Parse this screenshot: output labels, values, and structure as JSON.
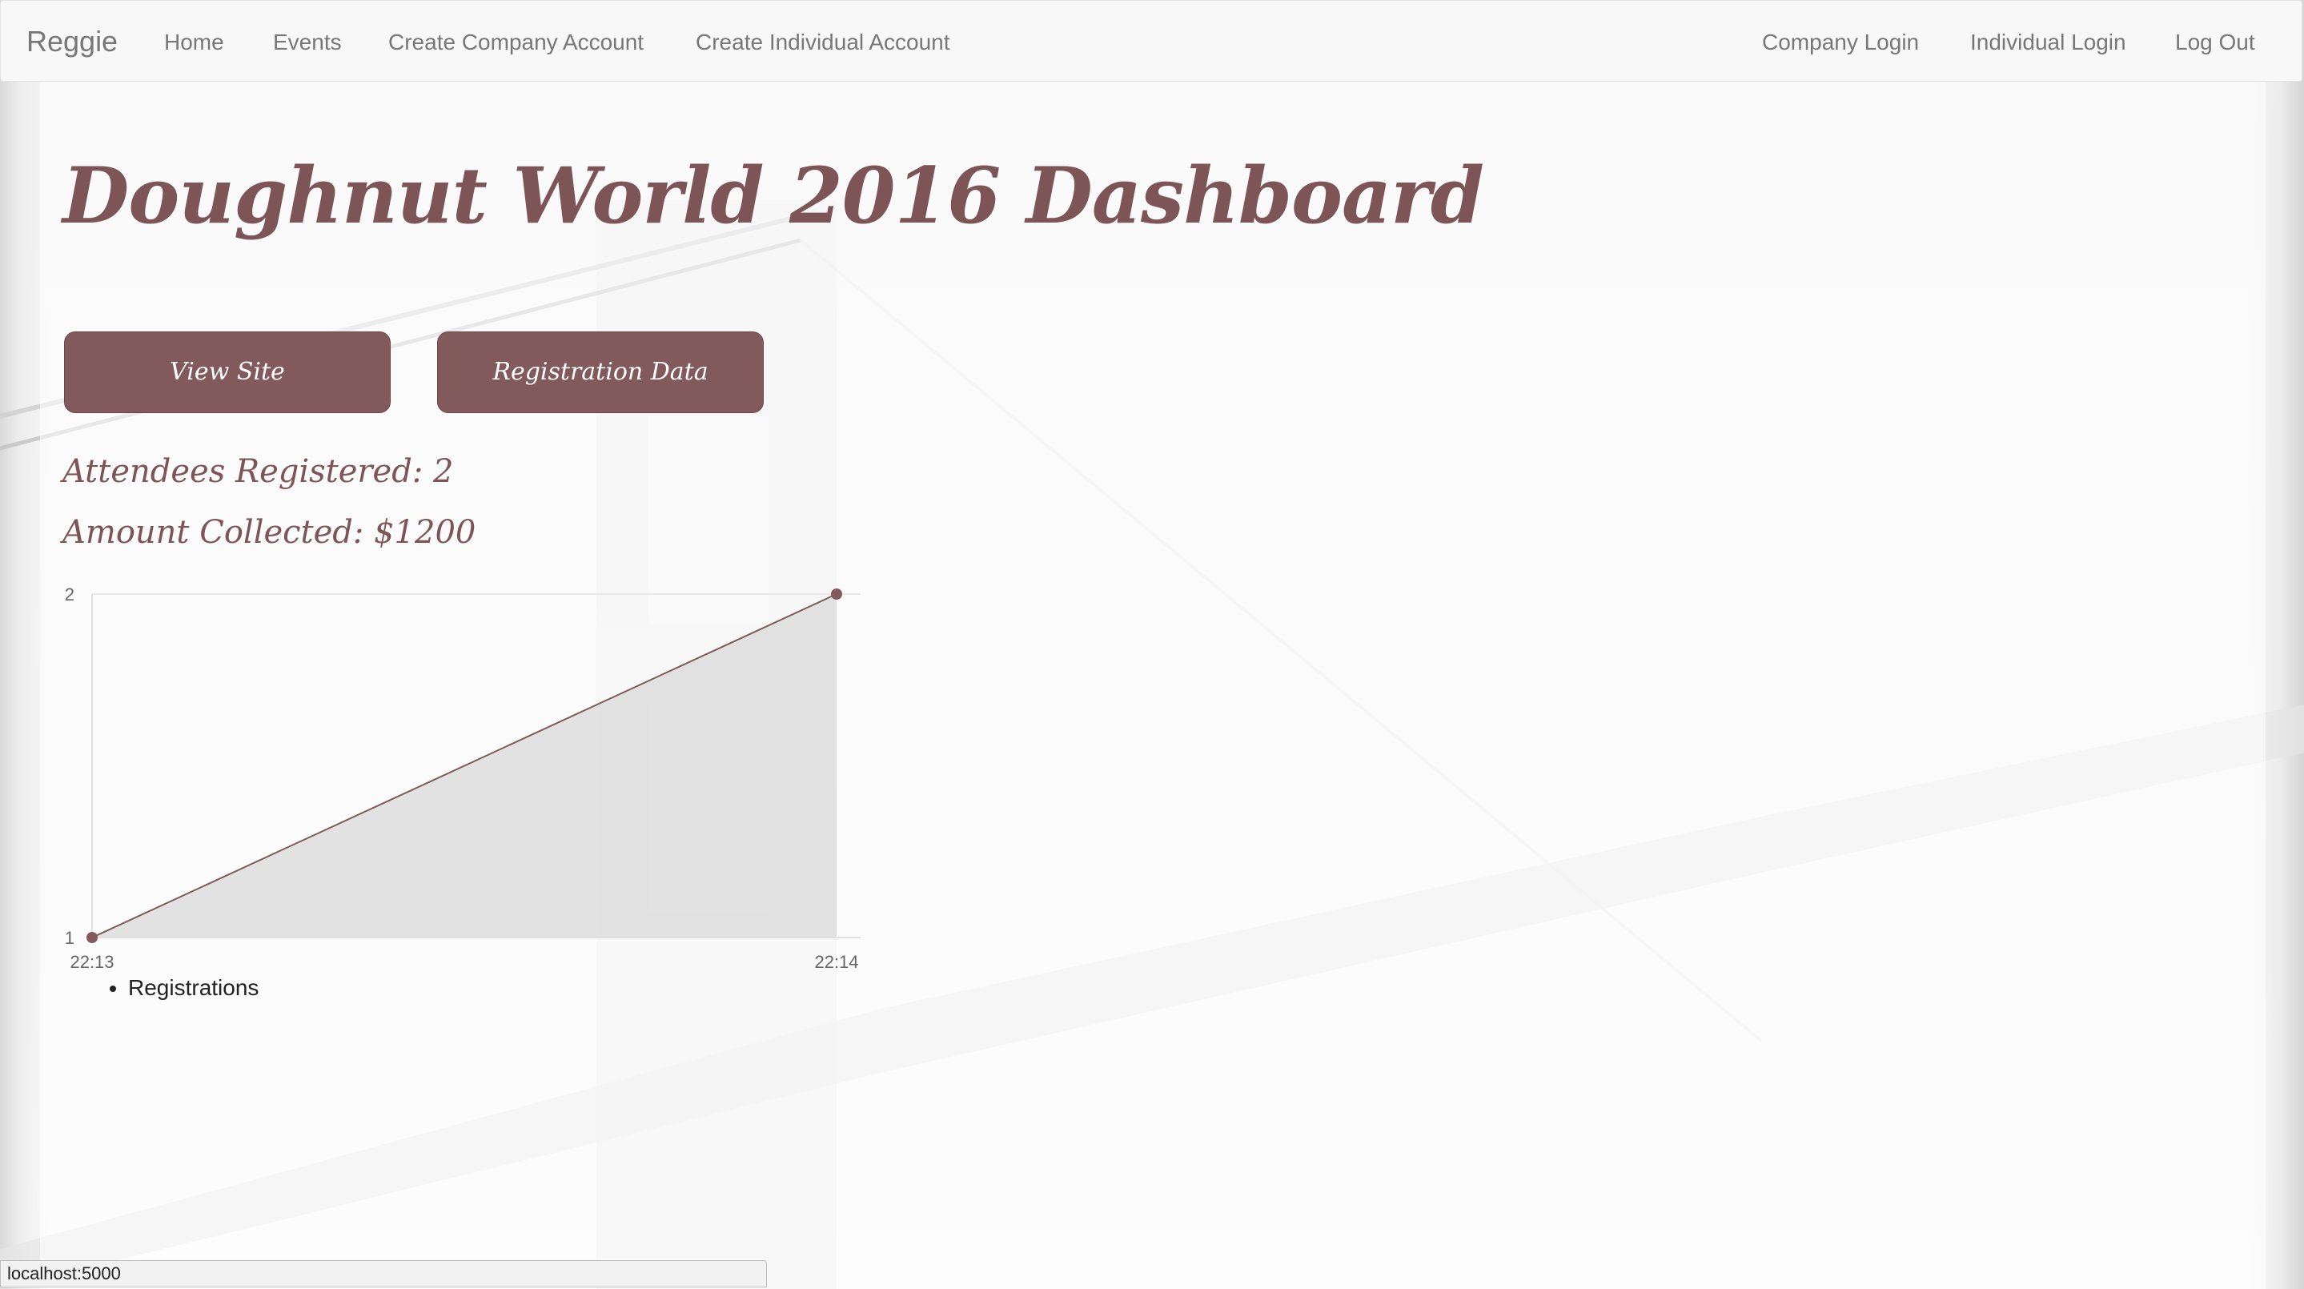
{
  "navbar": {
    "brand": "Reggie",
    "left_links": [
      "Home",
      "Events",
      "Create Company Account",
      "Create Individual Account"
    ],
    "right_links": [
      "Company Login",
      "Individual Login",
      "Log Out"
    ]
  },
  "page": {
    "title": "Doughnut World 2016 Dashboard",
    "buttons": {
      "view_site": "View Site",
      "registration_data": "Registration Data"
    },
    "stats": {
      "attendees": "Attendees Registered: 2",
      "amount": "Amount Collected: $1200"
    }
  },
  "chart_data": {
    "type": "area",
    "x": [
      "22:13",
      "22:14"
    ],
    "series": [
      {
        "name": "Registrations",
        "values": [
          1,
          2
        ]
      }
    ],
    "y_ticks": [
      "1",
      "2"
    ],
    "ylim": [
      1,
      2
    ],
    "legend": "bottom-left",
    "colors": {
      "line": "#825a5b",
      "fill": "#dddddd"
    }
  },
  "statusbar": {
    "url": "localhost:5000"
  },
  "colors": {
    "accent": "#825a5b",
    "title": "#7e5556",
    "nav_text": "#777777"
  }
}
